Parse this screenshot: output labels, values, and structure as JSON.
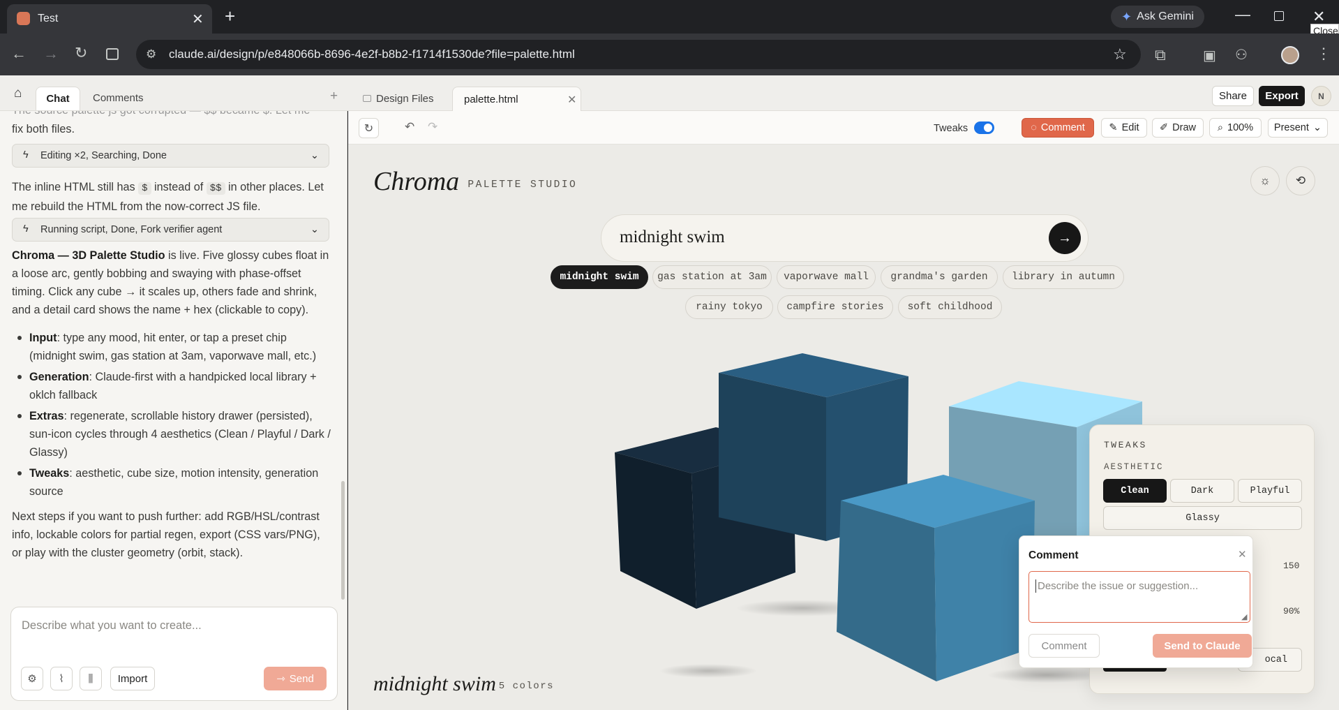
{
  "browser": {
    "tab_title": "Test",
    "new_tab": "+",
    "ask_gemini": "Ask Gemini",
    "tooltip": "Close",
    "url": "claude.ai/design/p/e848066b-8696-4e2f-b8b2-f1714f1530de?file=palette.html"
  },
  "app": {
    "left_tabs": [
      "Chat",
      "Comments"
    ],
    "file_tabs": [
      "Design Files",
      "palette.html"
    ],
    "share": "Share",
    "export": "Export",
    "avatar": "N"
  },
  "chat": {
    "partial_top": "The source palette js got corrupted — $$ became $. Let me",
    "para0": "fix both files.",
    "tool1": "Editing ×2, Searching, Done",
    "para1_a": "The inline HTML still has ",
    "para1_code1": "$",
    "para1_b": " instead of ",
    "para1_code2": "$$",
    "para1_c": " in other places. Let me rebuild the HTML from the now-correct JS file.",
    "tool2": "Running script, Done, Fork verifier agent",
    "para2_bold": "Chroma — 3D Palette Studio",
    "para2_rest": " is live. Five glossy cubes float in a loose arc, gently bobbing and swaying with phase-offset timing. Click any cube → it scales up, others fade and shrink, and a detail card shows the name + hex (clickable to copy).",
    "bullets": [
      {
        "b": "Input",
        "t": ": type any mood, hit enter, or tap a preset chip (midnight swim, gas station at 3am, vaporwave mall, etc.)"
      },
      {
        "b": "Generation",
        "t": ": Claude-first with a handpicked local library + oklch fallback"
      },
      {
        "b": "Extras",
        "t": ": regenerate, scrollable history drawer (persisted), sun-icon cycles through 4 aesthetics (Clean / Playful / Dark / Glassy)"
      },
      {
        "b": "Tweaks",
        "t": ": aesthetic, cube size, motion intensity, generation source"
      }
    ],
    "para3": "Next steps if you want to push further: add RGB/HSL/contrast info, lockable colors for partial regen, export (CSS vars/PNG), or play with the cluster geometry (orbit, stack).",
    "composer_placeholder": "Describe what you want to create...",
    "import": "Import",
    "send": "Send"
  },
  "toolbar": {
    "tweaks": "Tweaks",
    "tweaks_on": true,
    "comment": "Comment",
    "edit": "Edit",
    "draw": "Draw",
    "zoom": "100%",
    "present": "Present"
  },
  "canvas": {
    "brand": "Chroma",
    "brand_sub": "· PALETTE STUDIO",
    "search_value": "midnight swim",
    "chips": [
      "midnight swim",
      "gas station at 3am",
      "vaporwave mall",
      "grandma's garden",
      "library in autumn",
      "rainy tokyo",
      "campfire stories",
      "soft childhood"
    ],
    "active_chip": "midnight swim",
    "palette_name": "midnight swim",
    "palette_count": "· 5 colors",
    "cube_colors": [
      "#142636",
      "#24506e",
      "#3f82a8",
      "#8fc3db",
      "#b6dcec"
    ]
  },
  "tweaks": {
    "title": "TWEAKS",
    "section": "AESTHETIC",
    "options": [
      "Clean",
      "Dark",
      "Playful",
      "Glassy"
    ],
    "selected": "Clean",
    "val1": "150",
    "val2": "90%",
    "partial_opt": "ocal"
  },
  "comment_popup": {
    "title": "Comment",
    "placeholder": "Describe the issue or suggestion...",
    "cancel": "Comment",
    "send": "Send to Claude"
  },
  "colors": {
    "accent": "#d9603f",
    "toggle": "#1a73e8",
    "dark": "#171717"
  }
}
